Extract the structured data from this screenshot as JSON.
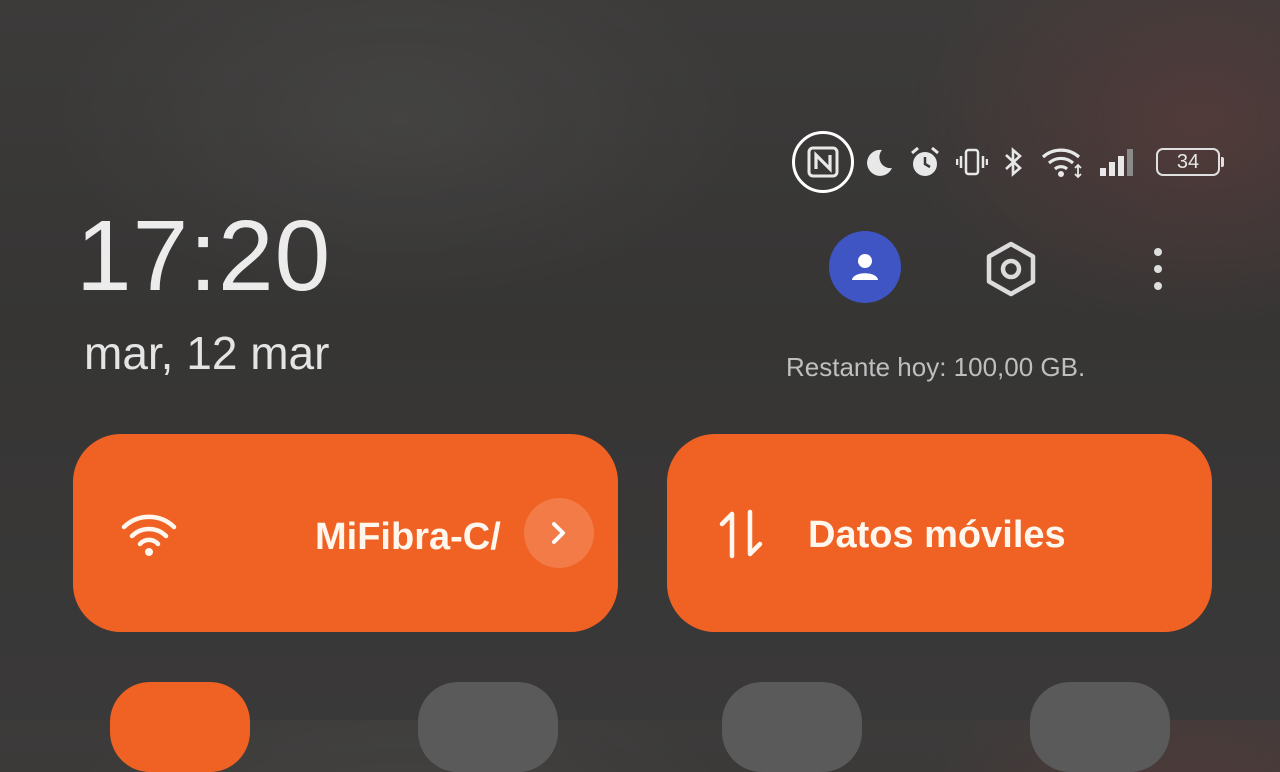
{
  "status_bar": {
    "icons": [
      "nfc-icon",
      "moon-icon",
      "alarm-icon",
      "vibrate-icon",
      "bluetooth-icon",
      "wifi-icon",
      "signal-icon"
    ],
    "battery_level": "34"
  },
  "lock": {
    "time": "17:20",
    "date": "mar, 12 mar"
  },
  "header_actions": {
    "account_icon": "person-icon",
    "settings_icon": "settings-icon",
    "more_icon": "more-vertical-icon",
    "data_remaining": "Restante hoy: 100,00 GB."
  },
  "tiles": {
    "wifi": {
      "label": "MiFibra-C/",
      "icon": "wifi-icon",
      "active": true
    },
    "mobile_data": {
      "label": "Datos móviles",
      "icon": "data-arrows-icon",
      "active": true
    }
  },
  "colors": {
    "accent": "#f06224",
    "avatar_bg": "#3f55c4",
    "inactive_tile": "#5a5a5a"
  }
}
